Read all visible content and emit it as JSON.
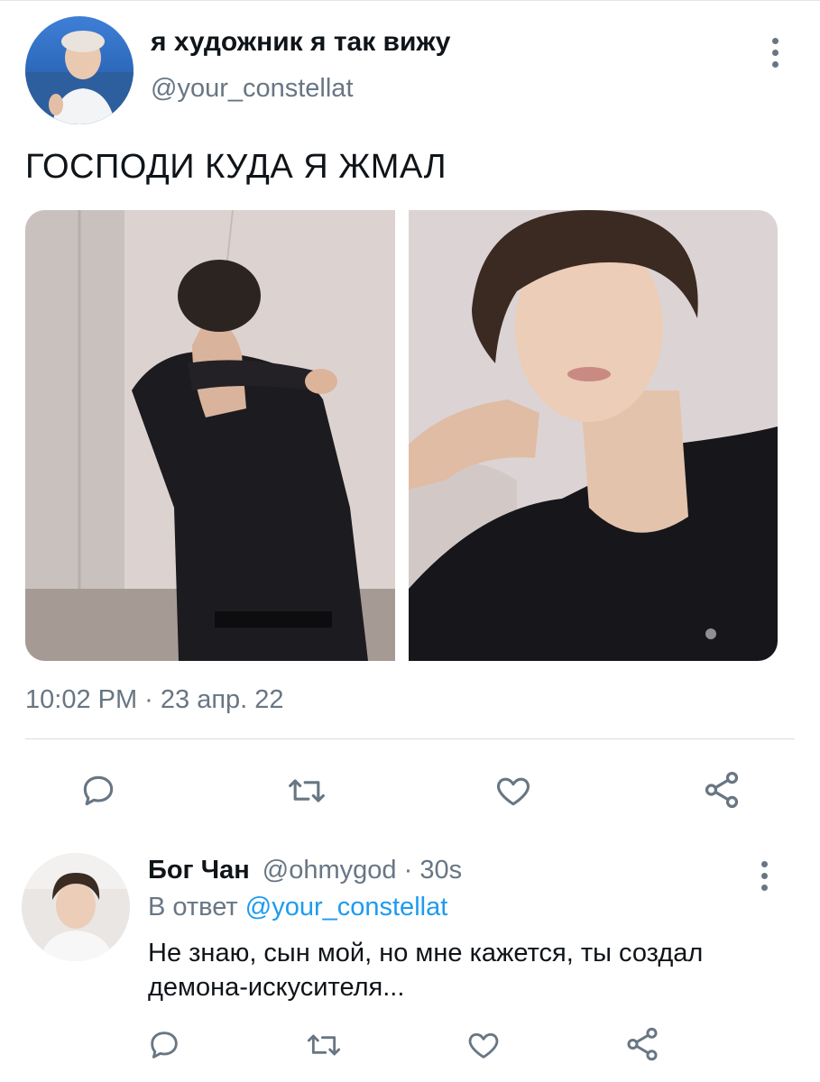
{
  "tweet": {
    "author_name": "я художник я так вижу",
    "author_handle": "@your_constellat",
    "text": "ГОСПОДИ КУДА Я ЖМАЛ",
    "timestamp": "10:02 PM · 23 апр. 22",
    "actions": [
      "reply-icon",
      "retweet-icon",
      "like-icon",
      "share-icon"
    ]
  },
  "reply": {
    "author_name": "Бог Чан",
    "author_handle": "@ohmygod",
    "separator": " · ",
    "time": "30s",
    "context_prefix": "В ответ",
    "context_mention": "@your_constellat",
    "text": "Не знаю, сын мой, но мне кажется, ты создал демона-искусителя...",
    "actions": [
      "reply-icon",
      "retweet-icon",
      "like-icon",
      "share-icon"
    ]
  },
  "colors": {
    "text_primary": "#0f1419",
    "text_secondary": "#687684",
    "link": "#1d9bf0",
    "divider": "#d9dee2"
  }
}
